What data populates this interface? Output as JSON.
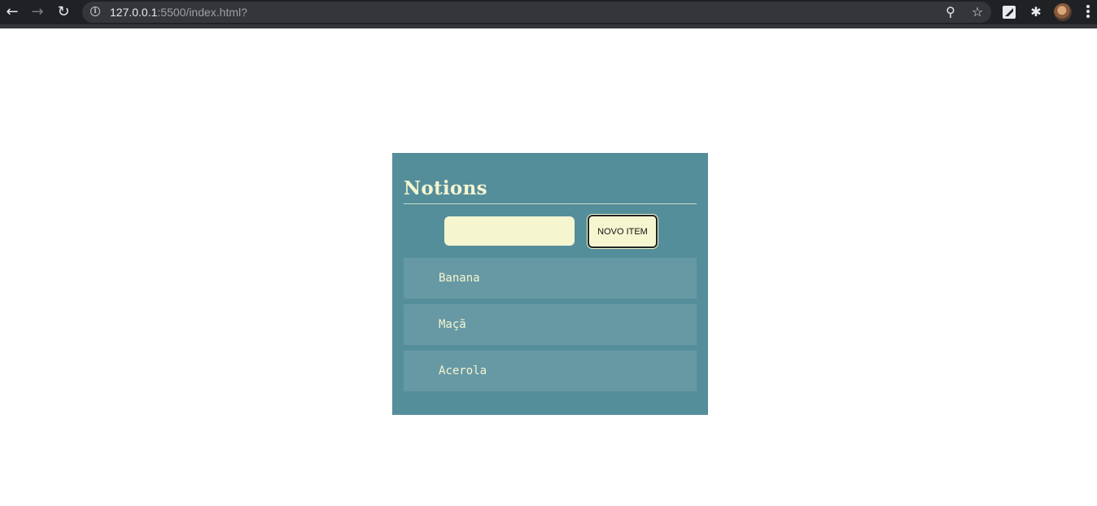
{
  "browser": {
    "url_host": "127.0.0.1",
    "url_rest": ":5500/index.html?",
    "icons": [
      "back-arrow-icon",
      "forward-arrow-icon",
      "reload-icon",
      "info-icon",
      "zoom-icon",
      "star-icon",
      "extension-icon",
      "puzzle-icon",
      "avatar",
      "menu-icon"
    ]
  },
  "app": {
    "title": "Notions",
    "input_value": "",
    "add_button_label": "NOVO ITEM",
    "items": [
      "Banana",
      "Maçã",
      "Acerola"
    ],
    "colors": {
      "card_bg": "#558e9b",
      "item_bg": "#6799a5",
      "cream": "#f5f6d0"
    }
  }
}
